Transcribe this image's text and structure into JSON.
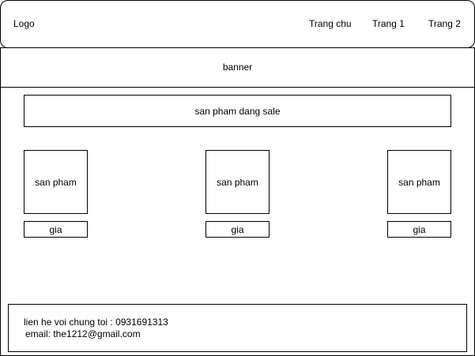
{
  "header": {
    "logo": "Logo",
    "nav": [
      "Trang chu",
      "Trang 1",
      "Trang 2"
    ]
  },
  "banner": {
    "label": "banner"
  },
  "sale_section": {
    "title": "san pham dang sale"
  },
  "products": [
    {
      "name": "san pham",
      "price": "gia"
    },
    {
      "name": "san pham",
      "price": "gia"
    },
    {
      "name": "san pham",
      "price": "gia"
    }
  ],
  "footer": {
    "contact": "lien he voi chung toi : 0931691313",
    "email": "email: the1212@gmail.com"
  }
}
